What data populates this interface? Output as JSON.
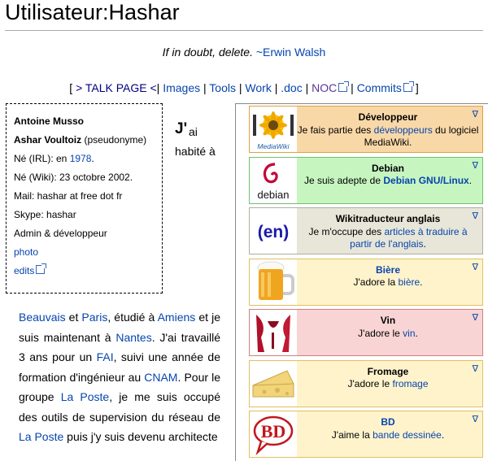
{
  "page": {
    "title": "Utilisateur:Hashar",
    "quote": "If in doubt, delete.",
    "quote_attrib": "~Erwin Walsh"
  },
  "nav": {
    "open": "[",
    "talk": "> TALK PAGE <",
    "sep": "|",
    "items": [
      "Images",
      "Tools",
      "Work",
      ".doc",
      "NOC",
      "Commits"
    ],
    "close": "]"
  },
  "infobox": {
    "name": "Antoine Musso",
    "pseudo_name": "Ashar Voultoiz",
    "pseudo_suffix": "(pseudonyme)",
    "born_irl_prefix": "Né (IRL): en",
    "born_irl_year": "1978",
    "born_irl_dot": ".",
    "born_wiki": "Né (Wiki): 23 octobre 2002.",
    "mail": "Mail: hashar at free dot fr",
    "skype": "Skype: hashar",
    "role": "Admin & développeur",
    "photo": "photo",
    "edits": "edits"
  },
  "intro": {
    "cap": "J'",
    "rest": "ai",
    "line2": "habité à"
  },
  "body": {
    "t1": "Beauvais",
    "t2": " et ",
    "t3": "Paris",
    "t4": ", étudié à ",
    "t5": "Amiens",
    "t6": " et je suis maintenant à ",
    "t7": "Nantes",
    "t8": ". J'ai travaillé 3 ans pour un ",
    "t9": "FAI",
    "t10": ", suivi une année de formation d'ingénieur au ",
    "t11": "CNAM",
    "t12": ". Pour le groupe ",
    "t13": "La Poste",
    "t14": ", je me suis occupé des outils de supervision du réseau de ",
    "t15": "La Poste",
    "t16": " puis j'y suis devenu architecte"
  },
  "userboxes": [
    {
      "title": "Développeur",
      "l1": "Je fais partie des ",
      "link1": "développeurs",
      "l2": " du logiciel MediaWiki.",
      "link2": "",
      "l3": "",
      "logo_text": "MediaWiki",
      "bg": "#f9d8a8",
      "border": "#e0a040"
    },
    {
      "title": "Debian",
      "l1": "Je suis adepte de ",
      "link1": "Debian GNU/Linux",
      "l2": ".",
      "link2": "",
      "l3": "",
      "logo_text": "debian",
      "bg": "#c6f5c0",
      "border": "#70c070"
    },
    {
      "title": "Wikitraducteur anglais",
      "l1": "Je m'occupe des ",
      "link1": "articles à traduire à partir de l'anglais",
      "l2": ".",
      "link2": "",
      "l3": "",
      "logo_text": "(en)",
      "bg": "#e8e6d8",
      "border": "#b0ae9e"
    },
    {
      "title": "Bière",
      "l1": "J'adore la ",
      "link1": "bière",
      "l2": ".",
      "link2": "",
      "l3": "",
      "logo_text": "",
      "bg": "#fff3cc",
      "border": "#e0c060",
      "title_link": true
    },
    {
      "title": "Vin",
      "l1": "J'adore le ",
      "link1": "vin",
      "l2": ".",
      "link2": "",
      "l3": "",
      "logo_text": "",
      "bg": "#f9d4d4",
      "border": "#d08080"
    },
    {
      "title": "Fromage",
      "l1": "J'adore le ",
      "link1": "fromage",
      "l2": "",
      "link2": "",
      "l3": "",
      "logo_text": "",
      "bg": "#fff3cc",
      "border": "#e0c060"
    },
    {
      "title": "BD",
      "l1": "J'aime la ",
      "link1": "bande dessinée",
      "l2": ".",
      "link2": "",
      "l3": "",
      "logo_text": "BD",
      "bg": "#fff3cc",
      "border": "#e0c060",
      "title_link": true
    }
  ],
  "userbox_toggle": "∇"
}
